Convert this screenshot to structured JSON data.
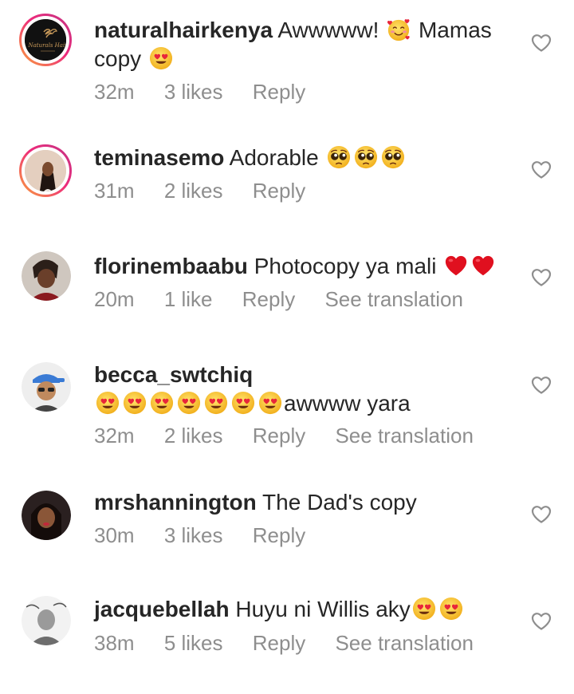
{
  "comments": [
    {
      "username": "naturalhairkenya",
      "text_before": "Awwwww!",
      "text_after": "Mamas",
      "text_line2": "copy",
      "time": "32m",
      "likes": "3 likes",
      "reply": "Reply",
      "emojis": [
        "smiling-face-with-hearts-emoji",
        "heart-eyes-emoji"
      ]
    },
    {
      "username": "teminasemo",
      "text": "Adorable",
      "time": "31m",
      "likes": "2 likes",
      "reply": "Reply",
      "emojis": [
        "pleading-face-emoji",
        "pleading-face-emoji",
        "pleading-face-emoji"
      ]
    },
    {
      "username": "florinembaabu",
      "text": "Photocopy ya mali",
      "time": "20m",
      "likes": "1 like",
      "reply": "Reply",
      "translation": "See translation",
      "emojis": [
        "red-heart-emoji",
        "red-heart-emoji"
      ]
    },
    {
      "username": "becca_swtchiq",
      "text": "awwww yara",
      "time": "32m",
      "likes": "2 likes",
      "reply": "Reply",
      "translation": "See translation",
      "emojis": [
        "heart-eyes-emoji",
        "heart-eyes-emoji",
        "heart-eyes-emoji",
        "heart-eyes-emoji",
        "heart-eyes-emoji",
        "heart-eyes-emoji",
        "heart-eyes-emoji"
      ]
    },
    {
      "username": "mrshannington",
      "text": "The Dad's copy",
      "time": "30m",
      "likes": "3 likes",
      "reply": "Reply"
    },
    {
      "username": "jacquebellah",
      "text": "Huyu ni Willis aky",
      "time": "38m",
      "likes": "5 likes",
      "reply": "Reply",
      "translation": "See translation",
      "emojis": [
        "heart-eyes-emoji",
        "heart-eyes-emoji"
      ]
    }
  ],
  "avatar_logo_text": "Naturals Hair",
  "colors": {
    "text": "#262626",
    "meta": "#8e8e8e",
    "story_ring_start": "#f9a33b",
    "story_ring_end": "#c13584",
    "heart_red": "#e0101f",
    "emoji_yellow": "#f8c536"
  }
}
